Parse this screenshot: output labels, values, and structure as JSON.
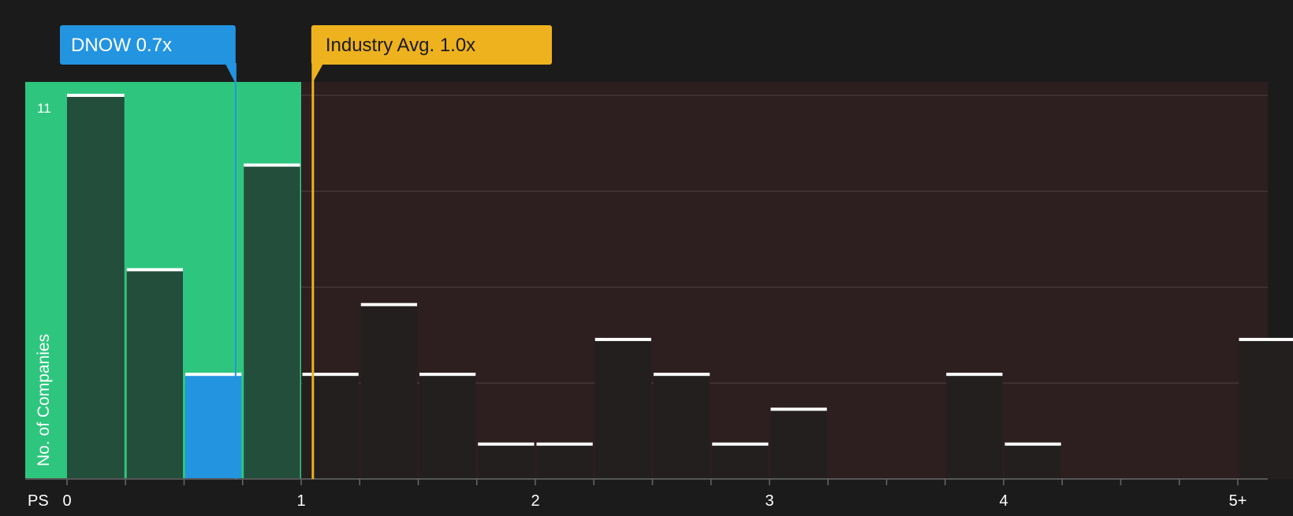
{
  "chart_data": {
    "type": "bar",
    "xlabel": "PS",
    "ylabel": "No. of Companies",
    "y_top_tick": "11",
    "ylim": [
      0,
      11
    ],
    "xlim": [
      0,
      5.2
    ],
    "x_ticks": [
      {
        "value": 0,
        "label": "0"
      },
      {
        "value": 1,
        "label": "1"
      },
      {
        "value": 2,
        "label": "2"
      },
      {
        "value": 3,
        "label": "3"
      },
      {
        "value": 4,
        "label": "4"
      },
      {
        "value": 5,
        "label": "5+"
      }
    ],
    "bin_width": 0.25,
    "bins": [
      {
        "start": 0.0,
        "count": 11
      },
      {
        "start": 0.25,
        "count": 6
      },
      {
        "start": 0.5,
        "count": 3,
        "highlight": true
      },
      {
        "start": 0.75,
        "count": 9
      },
      {
        "start": 1.0,
        "count": 3
      },
      {
        "start": 1.25,
        "count": 5
      },
      {
        "start": 1.5,
        "count": 3
      },
      {
        "start": 1.75,
        "count": 1
      },
      {
        "start": 2.0,
        "count": 1
      },
      {
        "start": 2.25,
        "count": 4
      },
      {
        "start": 2.5,
        "count": 3
      },
      {
        "start": 2.75,
        "count": 1
      },
      {
        "start": 3.0,
        "count": 2
      },
      {
        "start": 3.25,
        "count": 0
      },
      {
        "start": 3.5,
        "count": 0
      },
      {
        "start": 3.75,
        "count": 3
      },
      {
        "start": 4.0,
        "count": 1
      },
      {
        "start": 4.25,
        "count": 0
      },
      {
        "start": 4.5,
        "count": 0
      },
      {
        "start": 4.75,
        "count": 0
      },
      {
        "start": 5.0,
        "count": 4
      }
    ],
    "company": {
      "label": "DNOW 0.7x",
      "value": 0.72
    },
    "industry_avg": {
      "label": "Industry Avg. 1.0x",
      "value": 1.05
    },
    "undervalued_region_end": 1.0,
    "colors": {
      "background": "#1b1b1b",
      "undervalued_region": "#2ec67e",
      "overvalued_region": "#2d1f1f",
      "bar_in_green": "#234e3b",
      "bar_in_red": "#231f1f",
      "highlight_bar": "#2394e0",
      "company_badge": "#2394e0",
      "industry_badge": "#eeb21f",
      "bar_top_line": "#ffffff"
    }
  }
}
